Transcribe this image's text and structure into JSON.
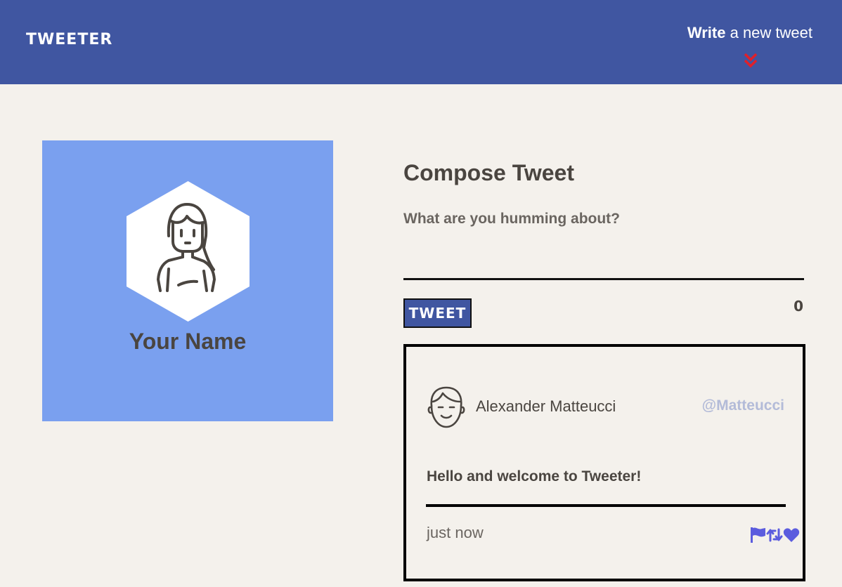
{
  "nav": {
    "brand": "TWEETER",
    "write_bold": "Write",
    "write_rest": " a new tweet"
  },
  "profile": {
    "name": "Your Name"
  },
  "compose": {
    "title": "Compose Tweet",
    "label": "What are you humming about?",
    "input_value": "",
    "button_label": "TWEET",
    "counter": "0"
  },
  "tweet": {
    "author_name": "Alexander Matteucci",
    "handle": "@Matteucci",
    "text": "Hello and welcome to Tweeter!",
    "timestamp": "just now",
    "icons": [
      "flag-icon",
      "retweet-icon",
      "heart-icon"
    ]
  },
  "colors": {
    "nav_bg": "#4056a1",
    "page_bg": "#f4f1ec",
    "profile_bg": "#7aa0ef",
    "accent_red": "#e0202a",
    "icon_accent": "#5b5cde",
    "handle": "#b3bbd8"
  }
}
